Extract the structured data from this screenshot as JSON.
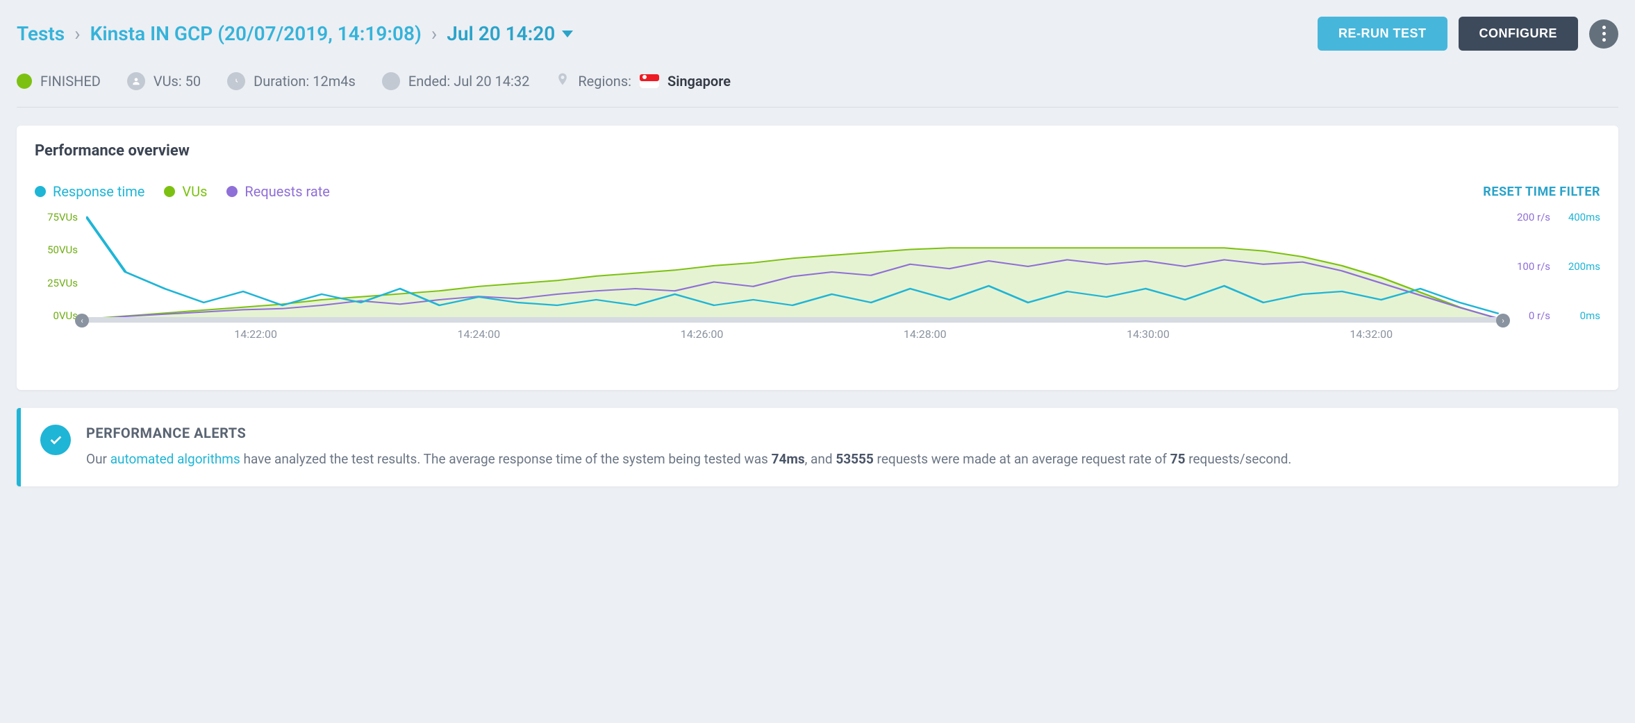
{
  "breadcrumb": {
    "root": "Tests",
    "project": "Kinsta IN GCP (20/07/2019, 14:19:08)",
    "current": "Jul 20 14:20"
  },
  "actions": {
    "rerun": "RE-RUN TEST",
    "configure": "CONFIGURE"
  },
  "meta": {
    "status": "FINISHED",
    "vus_label": "VUs: 50",
    "duration_label": "Duration: 12m4s",
    "ended_label": "Ended: Jul 20 14:32",
    "regions_label": "Regions:",
    "region_name": "Singapore"
  },
  "overview": {
    "title": "Performance overview",
    "legend": {
      "rt": "Response time",
      "vu": "VUs",
      "rr": "Requests rate"
    },
    "reset": "RESET TIME FILTER",
    "y_left": [
      "75VUs",
      "50VUs",
      "25VUs",
      "0VUs"
    ],
    "y_right_reqs": [
      "200 r/s",
      "100 r/s",
      "0 r/s"
    ],
    "y_right_ms": [
      "400ms",
      "200ms",
      "0ms"
    ],
    "x_ticks": [
      "14:22:00",
      "14:24:00",
      "14:26:00",
      "14:28:00",
      "14:30:00",
      "14:32:00"
    ]
  },
  "alerts": {
    "title": "PERFORMANCE ALERTS",
    "text_pre": "Our ",
    "link": "automated algorithms",
    "text_mid1": " have analyzed the test results. The average response time of the system being tested was ",
    "avg_rt": "74ms",
    "text_mid2": ", and ",
    "req_count": "53555",
    "text_mid3": " requests were made at an average request rate of ",
    "avg_rate": "75",
    "text_tail": " requests/second."
  },
  "chart_data": {
    "type": "line",
    "title": "Performance overview",
    "x": [
      "14:21:00",
      "14:21:20",
      "14:21:40",
      "14:22:00",
      "14:22:20",
      "14:22:40",
      "14:23:00",
      "14:23:20",
      "14:23:40",
      "14:24:00",
      "14:24:20",
      "14:24:40",
      "14:25:00",
      "14:25:20",
      "14:25:40",
      "14:26:00",
      "14:26:20",
      "14:26:40",
      "14:27:00",
      "14:27:20",
      "14:27:40",
      "14:28:00",
      "14:28:20",
      "14:28:40",
      "14:29:00",
      "14:29:20",
      "14:29:40",
      "14:30:00",
      "14:30:20",
      "14:30:40",
      "14:31:00",
      "14:31:20",
      "14:31:40",
      "14:32:00",
      "14:32:20",
      "14:32:40",
      "14:33:00"
    ],
    "series": [
      {
        "name": "VUs",
        "axis": "left",
        "ylabel": "VUs",
        "ylim": [
          0,
          75
        ],
        "values": [
          2,
          4,
          6,
          8,
          10,
          12,
          15,
          17,
          19,
          21,
          24,
          26,
          28,
          31,
          33,
          35,
          38,
          40,
          43,
          45,
          47,
          49,
          50,
          50,
          50,
          50,
          50,
          50,
          50,
          50,
          48,
          44,
          38,
          30,
          20,
          10,
          2
        ]
      },
      {
        "name": "Requests rate",
        "axis": "right1",
        "ylabel": "r/s",
        "ylim": [
          0,
          200
        ],
        "values": [
          4,
          10,
          14,
          18,
          22,
          24,
          30,
          38,
          32,
          40,
          46,
          42,
          50,
          56,
          60,
          56,
          72,
          64,
          82,
          90,
          84,
          104,
          96,
          110,
          100,
          112,
          104,
          110,
          100,
          112,
          104,
          108,
          92,
          70,
          48,
          26,
          6
        ]
      },
      {
        "name": "Response time",
        "axis": "right2",
        "ylabel": "ms",
        "ylim": [
          0,
          400
        ],
        "values": [
          380,
          180,
          120,
          70,
          110,
          60,
          100,
          70,
          120,
          60,
          90,
          70,
          60,
          80,
          60,
          100,
          60,
          80,
          60,
          100,
          70,
          120,
          80,
          130,
          70,
          110,
          90,
          120,
          80,
          130,
          70,
          100,
          110,
          80,
          120,
          70,
          30
        ]
      }
    ],
    "x_ticks": [
      "14:22:00",
      "14:24:00",
      "14:26:00",
      "14:28:00",
      "14:30:00",
      "14:32:00"
    ]
  }
}
